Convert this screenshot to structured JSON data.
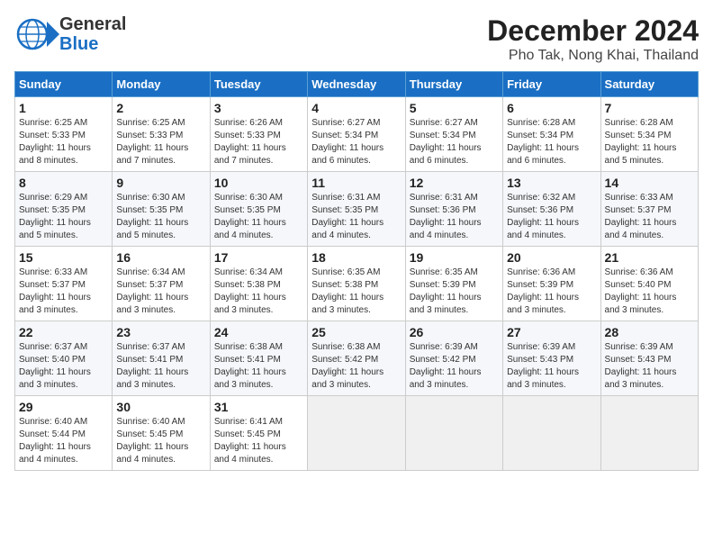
{
  "app": {
    "logo_line1": "General",
    "logo_line2": "Blue"
  },
  "title": "December 2024",
  "subtitle": "Pho Tak, Nong Khai, Thailand",
  "days_of_week": [
    "Sunday",
    "Monday",
    "Tuesday",
    "Wednesday",
    "Thursday",
    "Friday",
    "Saturday"
  ],
  "weeks": [
    [
      {
        "day": "1",
        "info": "Sunrise: 6:25 AM\nSunset: 5:33 PM\nDaylight: 11 hours\nand 8 minutes."
      },
      {
        "day": "2",
        "info": "Sunrise: 6:25 AM\nSunset: 5:33 PM\nDaylight: 11 hours\nand 7 minutes."
      },
      {
        "day": "3",
        "info": "Sunrise: 6:26 AM\nSunset: 5:33 PM\nDaylight: 11 hours\nand 7 minutes."
      },
      {
        "day": "4",
        "info": "Sunrise: 6:27 AM\nSunset: 5:34 PM\nDaylight: 11 hours\nand 6 minutes."
      },
      {
        "day": "5",
        "info": "Sunrise: 6:27 AM\nSunset: 5:34 PM\nDaylight: 11 hours\nand 6 minutes."
      },
      {
        "day": "6",
        "info": "Sunrise: 6:28 AM\nSunset: 5:34 PM\nDaylight: 11 hours\nand 6 minutes."
      },
      {
        "day": "7",
        "info": "Sunrise: 6:28 AM\nSunset: 5:34 PM\nDaylight: 11 hours\nand 5 minutes."
      }
    ],
    [
      {
        "day": "8",
        "info": "Sunrise: 6:29 AM\nSunset: 5:35 PM\nDaylight: 11 hours\nand 5 minutes."
      },
      {
        "day": "9",
        "info": "Sunrise: 6:30 AM\nSunset: 5:35 PM\nDaylight: 11 hours\nand 5 minutes."
      },
      {
        "day": "10",
        "info": "Sunrise: 6:30 AM\nSunset: 5:35 PM\nDaylight: 11 hours\nand 4 minutes."
      },
      {
        "day": "11",
        "info": "Sunrise: 6:31 AM\nSunset: 5:35 PM\nDaylight: 11 hours\nand 4 minutes."
      },
      {
        "day": "12",
        "info": "Sunrise: 6:31 AM\nSunset: 5:36 PM\nDaylight: 11 hours\nand 4 minutes."
      },
      {
        "day": "13",
        "info": "Sunrise: 6:32 AM\nSunset: 5:36 PM\nDaylight: 11 hours\nand 4 minutes."
      },
      {
        "day": "14",
        "info": "Sunrise: 6:33 AM\nSunset: 5:37 PM\nDaylight: 11 hours\nand 4 minutes."
      }
    ],
    [
      {
        "day": "15",
        "info": "Sunrise: 6:33 AM\nSunset: 5:37 PM\nDaylight: 11 hours\nand 3 minutes."
      },
      {
        "day": "16",
        "info": "Sunrise: 6:34 AM\nSunset: 5:37 PM\nDaylight: 11 hours\nand 3 minutes."
      },
      {
        "day": "17",
        "info": "Sunrise: 6:34 AM\nSunset: 5:38 PM\nDaylight: 11 hours\nand 3 minutes."
      },
      {
        "day": "18",
        "info": "Sunrise: 6:35 AM\nSunset: 5:38 PM\nDaylight: 11 hours\nand 3 minutes."
      },
      {
        "day": "19",
        "info": "Sunrise: 6:35 AM\nSunset: 5:39 PM\nDaylight: 11 hours\nand 3 minutes."
      },
      {
        "day": "20",
        "info": "Sunrise: 6:36 AM\nSunset: 5:39 PM\nDaylight: 11 hours\nand 3 minutes."
      },
      {
        "day": "21",
        "info": "Sunrise: 6:36 AM\nSunset: 5:40 PM\nDaylight: 11 hours\nand 3 minutes."
      }
    ],
    [
      {
        "day": "22",
        "info": "Sunrise: 6:37 AM\nSunset: 5:40 PM\nDaylight: 11 hours\nand 3 minutes."
      },
      {
        "day": "23",
        "info": "Sunrise: 6:37 AM\nSunset: 5:41 PM\nDaylight: 11 hours\nand 3 minutes."
      },
      {
        "day": "24",
        "info": "Sunrise: 6:38 AM\nSunset: 5:41 PM\nDaylight: 11 hours\nand 3 minutes."
      },
      {
        "day": "25",
        "info": "Sunrise: 6:38 AM\nSunset: 5:42 PM\nDaylight: 11 hours\nand 3 minutes."
      },
      {
        "day": "26",
        "info": "Sunrise: 6:39 AM\nSunset: 5:42 PM\nDaylight: 11 hours\nand 3 minutes."
      },
      {
        "day": "27",
        "info": "Sunrise: 6:39 AM\nSunset: 5:43 PM\nDaylight: 11 hours\nand 3 minutes."
      },
      {
        "day": "28",
        "info": "Sunrise: 6:39 AM\nSunset: 5:43 PM\nDaylight: 11 hours\nand 3 minutes."
      }
    ],
    [
      {
        "day": "29",
        "info": "Sunrise: 6:40 AM\nSunset: 5:44 PM\nDaylight: 11 hours\nand 4 minutes."
      },
      {
        "day": "30",
        "info": "Sunrise: 6:40 AM\nSunset: 5:45 PM\nDaylight: 11 hours\nand 4 minutes."
      },
      {
        "day": "31",
        "info": "Sunrise: 6:41 AM\nSunset: 5:45 PM\nDaylight: 11 hours\nand 4 minutes."
      },
      null,
      null,
      null,
      null
    ]
  ]
}
